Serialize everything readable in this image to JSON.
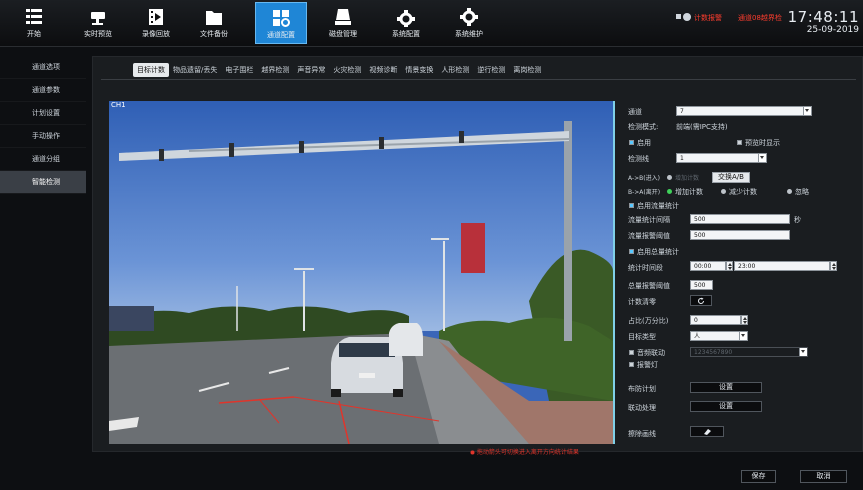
{
  "toolbar": {
    "items": [
      {
        "label": "开始",
        "icon": "menu-icon"
      },
      {
        "label": "实时预览",
        "icon": "camera-icon"
      },
      {
        "label": "录像回放",
        "icon": "film-icon"
      },
      {
        "label": "文件备份",
        "icon": "folder-icon"
      },
      {
        "label": "通道配置",
        "icon": "channel-config-icon"
      },
      {
        "label": "磁盘管理",
        "icon": "disk-icon"
      },
      {
        "label": "系统配置",
        "icon": "system-gear-icon"
      },
      {
        "label": "系统维护",
        "icon": "maintenance-gear-icon"
      }
    ],
    "alarm1": "计数报警",
    "alarm2": "通道08越界检",
    "time": "17:48:11",
    "date": "25-09-2019"
  },
  "sidebar": {
    "items": [
      "通道选项",
      "通道参数",
      "计划设置",
      "手动操作",
      "通道分组",
      "智能检测"
    ]
  },
  "tabs": [
    "目标计数",
    "物品遗留/丢失",
    "电子围栏",
    "越界检测",
    "声音异常",
    "火灾检测",
    "视频诊断",
    "情景变换",
    "人形检测",
    "逆行检测",
    "离岗检测"
  ],
  "video": {
    "channel_label": "CH1"
  },
  "form": {
    "channel_label": "通道",
    "channel_value": "7",
    "detect_mode_label": "检测模式:",
    "detect_mode_value": "前端(需IPC支持)",
    "enable_label": "启用",
    "preview_label": "预览时显示",
    "detect_line_label": "检测线",
    "detect_line_value": "1",
    "ab_in_label": "A->B(进入)",
    "ab_in_value": "增加计数",
    "swap_label": "交换A/B",
    "ba_out_label": "B->A(离开)",
    "ba_opt1": "增加计数",
    "ba_opt2": "减少计数",
    "ba_opt3": "忽略",
    "flow_enable_label": "启用流量统计",
    "flow_interval_label": "流量统计间隔",
    "flow_interval_value": "500",
    "flow_interval_unit": "秒",
    "flow_alarm_label": "流量报警阈值",
    "flow_alarm_value": "500",
    "total_enable_label": "启用总量统计",
    "stat_time_label": "统计时间段",
    "stat_time_start": "00:00",
    "stat_time_end": "23:00",
    "total_alarm_label": "总量报警阈值",
    "total_alarm_value": "500",
    "count_reset_label": "计数清零",
    "ratio_label": "占比(万分比)",
    "ratio_value": "0",
    "target_type_label": "目标类型",
    "target_type_value": "人",
    "audio_link_label": "音频联动",
    "audio_link_value": "1234567890",
    "alarm_light_label": "报警灯",
    "schedule_label": "布防计划",
    "schedule_btn": "设置",
    "linkage_label": "联动处理",
    "linkage_btn": "设置",
    "erase_label": "擦除画线"
  },
  "hint_text": "拖动箭头可切换进入离开方向统计结果",
  "footer": {
    "save": "保存",
    "cancel": "取消"
  },
  "colors": {
    "accent": "#1f86d6",
    "alarm": "#ff3d2e",
    "line_red": "#e0352b"
  }
}
